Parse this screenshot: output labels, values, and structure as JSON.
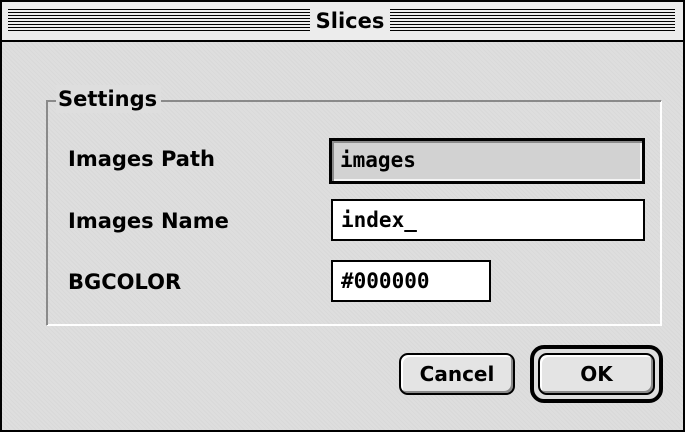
{
  "window": {
    "title": "Slices"
  },
  "settings": {
    "group_label": "Settings",
    "images_path": {
      "label": "Images Path",
      "value": "images"
    },
    "images_name": {
      "label": "Images Name",
      "value": "index_"
    },
    "bgcolor": {
      "label": "BGCOLOR",
      "value": "#000000"
    }
  },
  "buttons": {
    "cancel_label": "Cancel",
    "ok_label": "OK"
  }
}
